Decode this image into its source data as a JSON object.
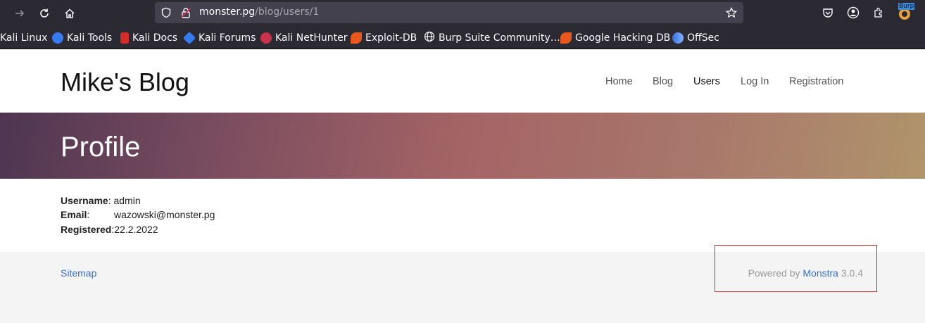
{
  "browser": {
    "url_host": "monster.pg",
    "url_path": "/blog/users/1",
    "bookmarks": [
      {
        "label": "Kali Linux",
        "icon": "kali-linux-icon"
      },
      {
        "label": "Kali Tools",
        "icon": "kali-tools-icon"
      },
      {
        "label": "Kali Docs",
        "icon": "kali-docs-icon"
      },
      {
        "label": "Kali Forums",
        "icon": "kali-forums-icon"
      },
      {
        "label": "Kali NetHunter",
        "icon": "kali-nethunter-icon"
      },
      {
        "label": "Exploit-DB",
        "icon": "exploit-db-icon"
      },
      {
        "label": "Burp Suite Community…",
        "icon": "globe-icon"
      },
      {
        "label": "Google Hacking DB",
        "icon": "exploit-db-icon"
      },
      {
        "label": "OffSec",
        "icon": "offsec-icon"
      }
    ],
    "burp_badge": "Burp"
  },
  "site": {
    "brand": "Mike's Blog",
    "menu": [
      {
        "label": "Home",
        "active": false
      },
      {
        "label": "Blog",
        "active": false
      },
      {
        "label": "Users",
        "active": true
      },
      {
        "label": "Log In",
        "active": false
      },
      {
        "label": "Registration",
        "active": false
      }
    ],
    "hero_title": "Profile",
    "profile": [
      {
        "key": "Username",
        "sep": ": ",
        "value": "admin"
      },
      {
        "key": "Email",
        "sep": ":",
        "value": "wazowski@monster.pg"
      },
      {
        "key": "Registered",
        "sep": ":",
        "value": "22.2.2022"
      }
    ],
    "footer": {
      "sitemap": "Sitemap",
      "powered_prefix": "Powered by ",
      "powered_link": "Monstra",
      "version": " 3.0.4"
    }
  },
  "colors": {
    "link": "#3a6fd8",
    "highlight_box": "#d02c2c"
  }
}
